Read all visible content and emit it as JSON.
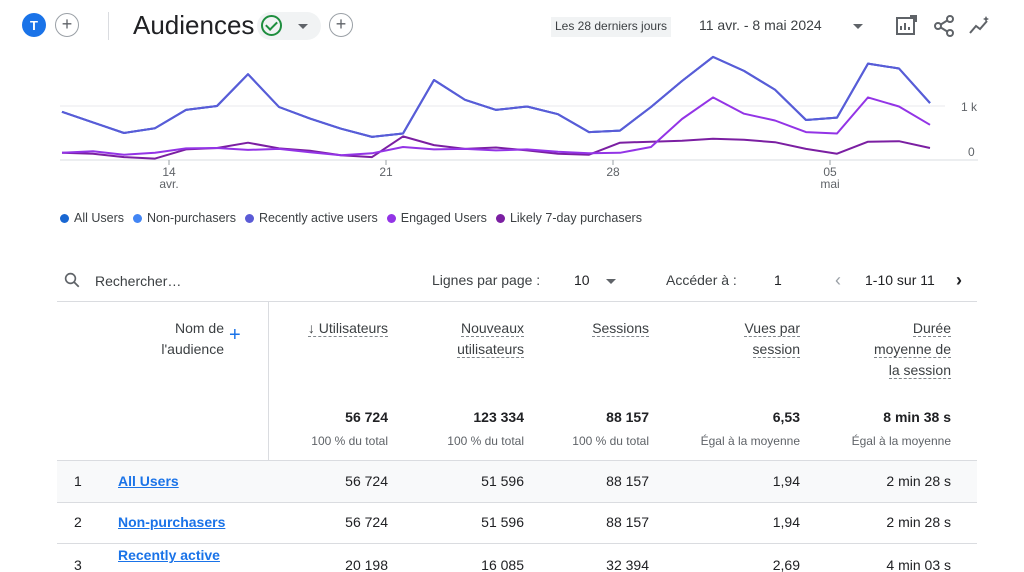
{
  "header": {
    "avatar_letter": "T",
    "title": "Audiences",
    "date_label": "Les 28 derniers jours",
    "date_range": "11 avr. - 8 mai 2024"
  },
  "chart_data": {
    "type": "line",
    "x_tick_labels": [
      {
        "day": "14",
        "month": "avr."
      },
      {
        "day": "21",
        "month": ""
      },
      {
        "day": "28",
        "month": ""
      },
      {
        "day": "05",
        "month": "mai"
      }
    ],
    "y_tick_labels": [
      "1 k",
      "0"
    ],
    "ylim": [
      0,
      2200
    ],
    "x": [
      "2024-04-11",
      "2024-04-12",
      "2024-04-13",
      "2024-04-14",
      "2024-04-15",
      "2024-04-16",
      "2024-04-17",
      "2024-04-18",
      "2024-04-19",
      "2024-04-20",
      "2024-04-21",
      "2024-04-22",
      "2024-04-23",
      "2024-04-24",
      "2024-04-25",
      "2024-04-26",
      "2024-04-27",
      "2024-04-28",
      "2024-04-29",
      "2024-04-30",
      "2024-05-01",
      "2024-05-02",
      "2024-05-03",
      "2024-05-04",
      "2024-05-05",
      "2024-05-06",
      "2024-05-07",
      "2024-05-08"
    ],
    "series": [
      {
        "name": "All Users",
        "color": "#1967d2",
        "values": [
          1000,
          780,
          560,
          660,
          1040,
          1120,
          1780,
          1100,
          860,
          650,
          480,
          550,
          1660,
          1250,
          1040,
          1110,
          950,
          580,
          610,
          1100,
          1640,
          2140,
          1850,
          1460,
          830,
          880,
          2000,
          1900,
          1180
        ]
      },
      {
        "name": "Non-purchasers",
        "color": "#4285f4",
        "values": [
          1000,
          780,
          560,
          660,
          1040,
          1120,
          1780,
          1100,
          860,
          650,
          480,
          550,
          1660,
          1250,
          1040,
          1110,
          950,
          580,
          610,
          1100,
          1640,
          2140,
          1850,
          1460,
          830,
          880,
          2000,
          1900,
          1180
        ]
      },
      {
        "name": "Recently active users",
        "color": "#5b5bd6",
        "values": [
          1000,
          780,
          560,
          660,
          1040,
          1120,
          1780,
          1100,
          860,
          650,
          480,
          550,
          1660,
          1250,
          1040,
          1110,
          950,
          580,
          610,
          1100,
          1640,
          2140,
          1850,
          1460,
          830,
          880,
          2000,
          1900,
          1180
        ]
      },
      {
        "name": "Engaged Users",
        "color": "#9334e6",
        "values": [
          150,
          180,
          110,
          150,
          240,
          250,
          210,
          230,
          160,
          100,
          140,
          270,
          220,
          230,
          200,
          220,
          170,
          140,
          150,
          270,
          850,
          1300,
          960,
          820,
          580,
          550,
          1300,
          1110,
          730
        ]
      },
      {
        "name": "Likely 7-day purchasers",
        "color": "#7b1fa2",
        "values": [
          150,
          130,
          60,
          30,
          220,
          250,
          360,
          240,
          190,
          100,
          60,
          490,
          310,
          230,
          260,
          200,
          130,
          110,
          360,
          380,
          400,
          440,
          420,
          370,
          230,
          130,
          380,
          390,
          250
        ]
      }
    ]
  },
  "toolbar": {
    "search_placeholder": "Rechercher…",
    "rows_per_page_label": "Lignes par page :",
    "rows_per_page_value": "10",
    "goto_label": "Accéder à :",
    "goto_value": "1",
    "page_range": "1-10 sur 11"
  },
  "table": {
    "dimension_header": [
      "Nom de",
      "l'audience"
    ],
    "columns": [
      {
        "lines": [
          "↓ Utilisateurs"
        ],
        "total": "56 724",
        "sub": "100 % du total"
      },
      {
        "lines": [
          "Nouveaux",
          "utilisateurs"
        ],
        "total": "123 334",
        "sub": "100 % du total"
      },
      {
        "lines": [
          "Sessions"
        ],
        "total": "88 157",
        "sub": "100 % du total"
      },
      {
        "lines": [
          "Vues par",
          "session"
        ],
        "total": "6,53",
        "sub": "Égal à la moyenne"
      },
      {
        "lines": [
          "Durée",
          "moyenne de",
          "la session"
        ],
        "total": "8 min 38 s",
        "sub": "Égal à la moyenne"
      }
    ],
    "rows": [
      {
        "num": "1",
        "name": "All Users",
        "values": [
          "56 724",
          "51 596",
          "88 157",
          "1,94",
          "2 min 28 s"
        ]
      },
      {
        "num": "2",
        "name": "Non-purchasers",
        "values": [
          "56 724",
          "51 596",
          "88 157",
          "1,94",
          "2 min 28 s"
        ]
      },
      {
        "num": "3",
        "name": "Recently active",
        "values": [
          "20 198",
          "16 085",
          "32 394",
          "2,69",
          "4 min 03 s"
        ]
      }
    ]
  }
}
